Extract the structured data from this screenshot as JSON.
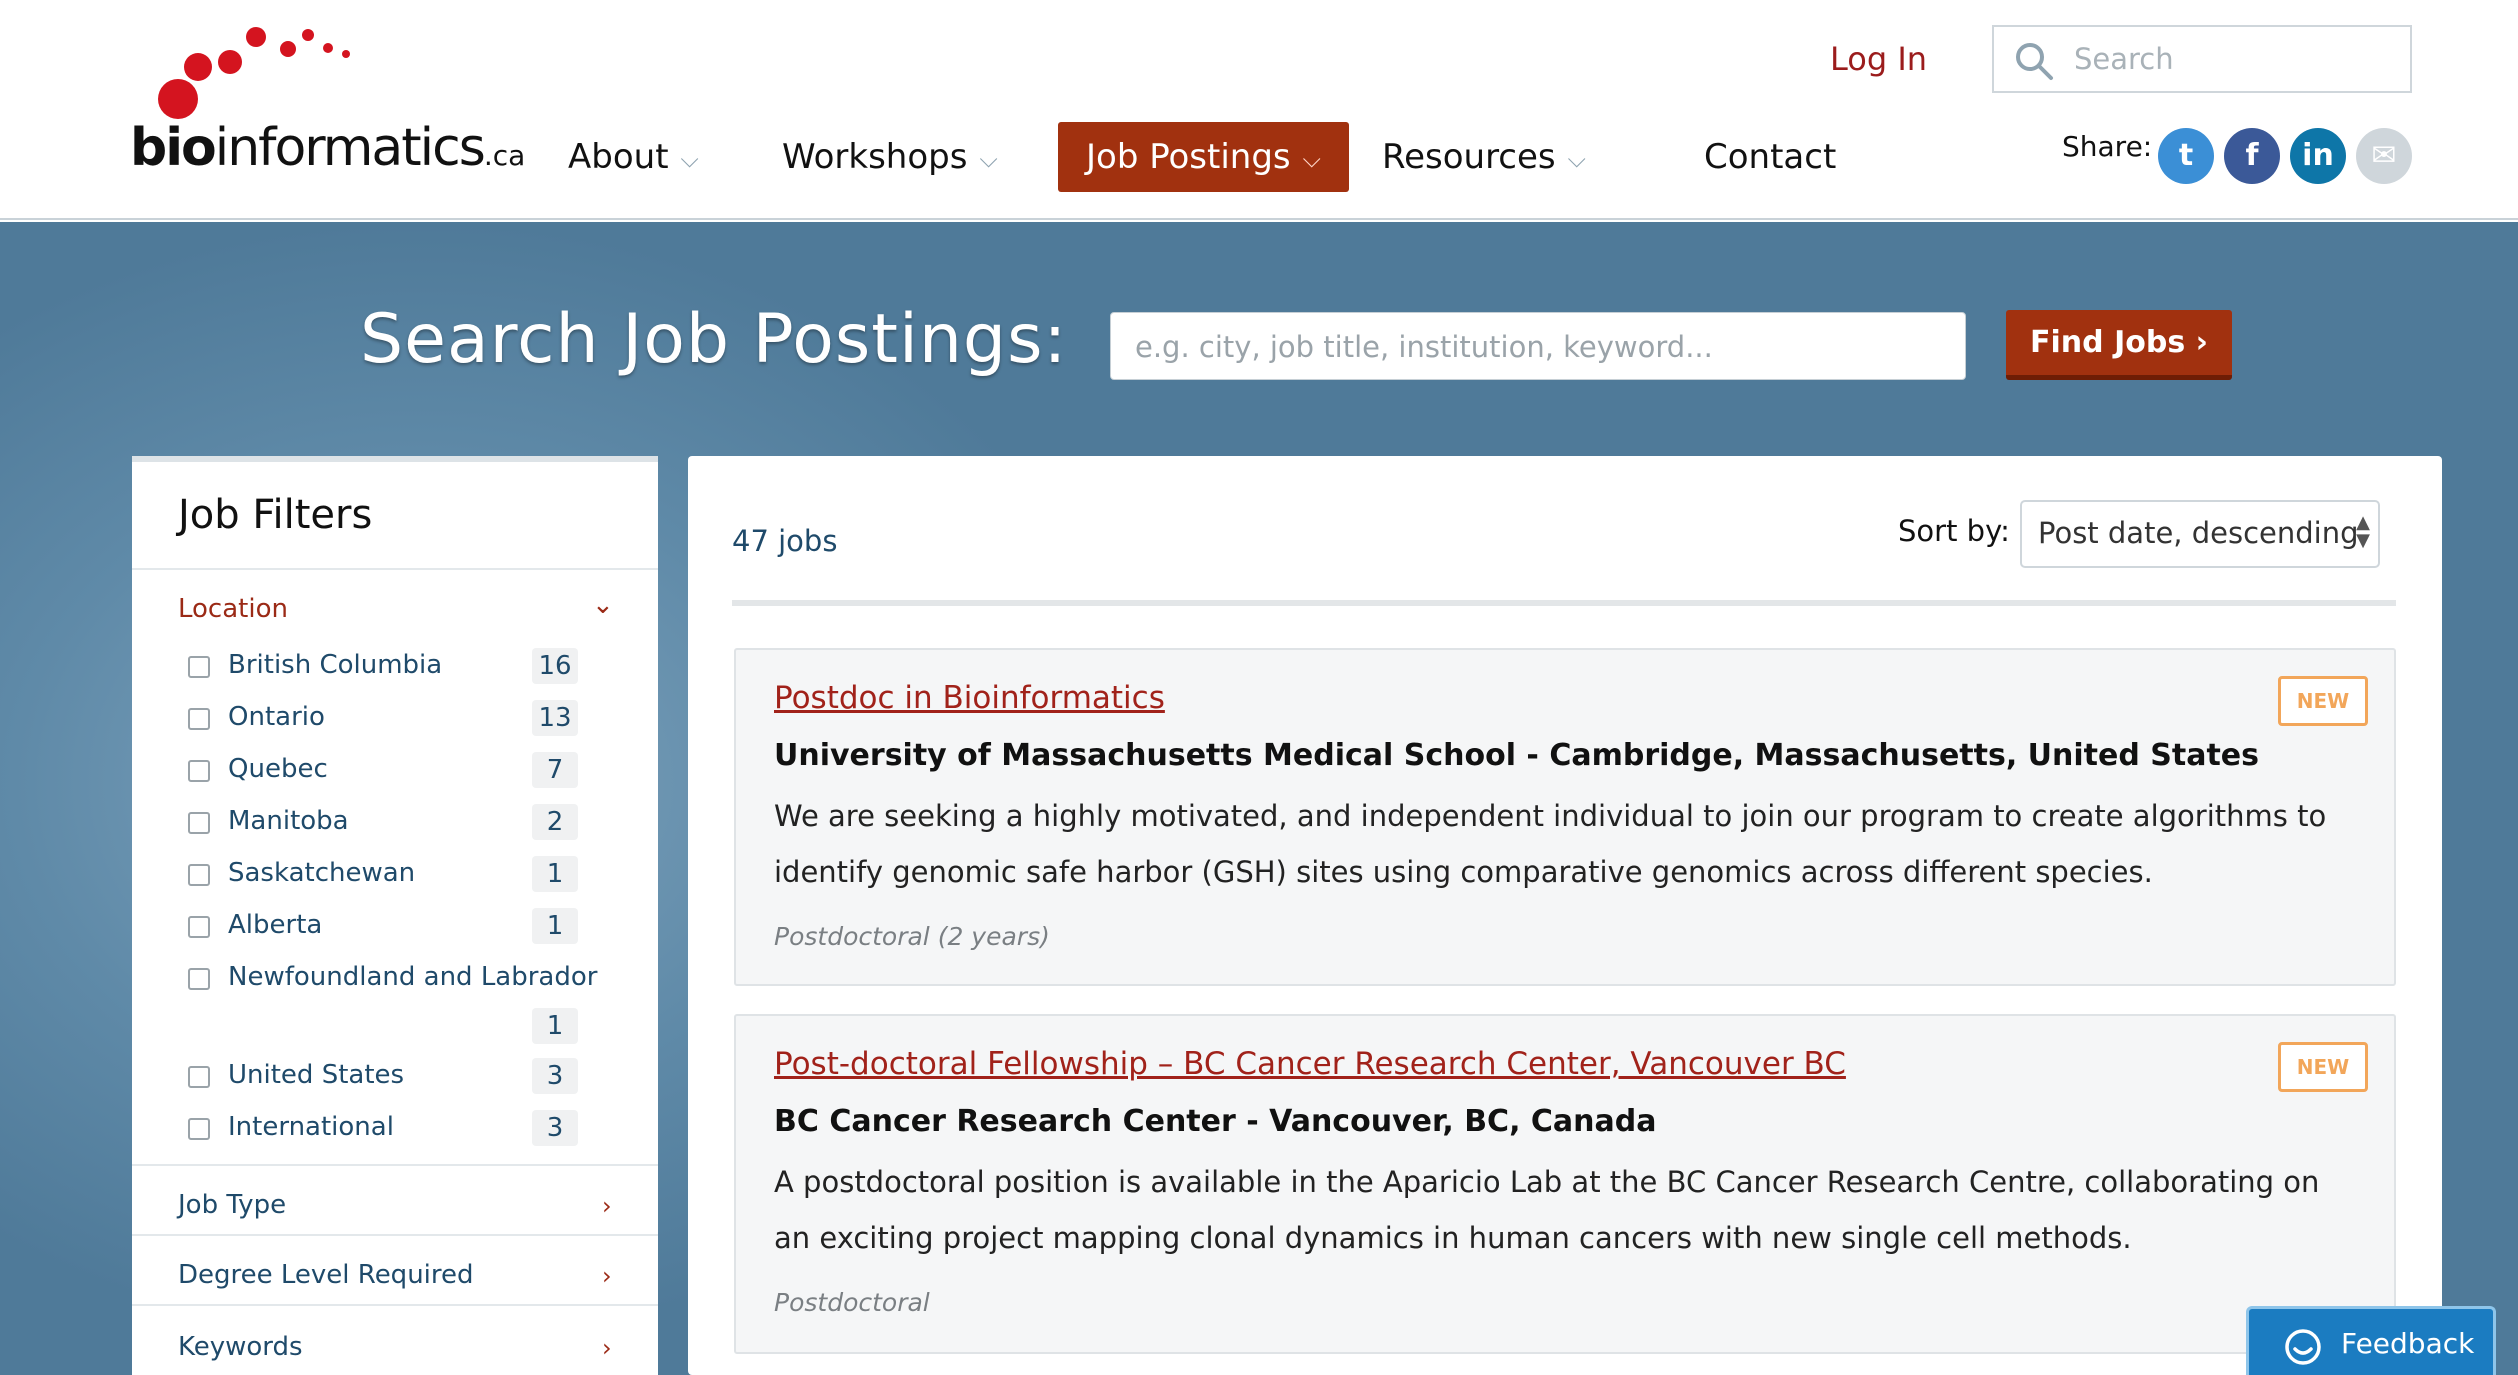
{
  "header": {
    "logo": {
      "bold": "bio",
      "rest": "informatics",
      "suffix": ".ca"
    },
    "login_label": "Log In",
    "search_placeholder": "Search",
    "nav": [
      {
        "label": "About",
        "has_dropdown": true
      },
      {
        "label": "Workshops",
        "has_dropdown": true
      },
      {
        "label": "Job Postings",
        "has_dropdown": true,
        "active": true
      },
      {
        "label": "Resources",
        "has_dropdown": true
      },
      {
        "label": "Contact",
        "has_dropdown": false
      }
    ],
    "share_label": "Share:",
    "share": [
      {
        "name": "twitter-icon",
        "glyph": "t"
      },
      {
        "name": "facebook-icon",
        "glyph": "f"
      },
      {
        "name": "linkedin-icon",
        "glyph": "in"
      },
      {
        "name": "email-icon",
        "glyph": "✉"
      }
    ]
  },
  "hero": {
    "title": "Search Job Postings:",
    "search_placeholder": "e.g. city, job title, institution, keyword...",
    "find_button": "Find Jobs ›"
  },
  "filters": {
    "title": "Job Filters",
    "location": {
      "label": "Location",
      "expanded": true,
      "items": [
        {
          "label": "British Columbia",
          "count": "16",
          "checked": false
        },
        {
          "label": "Ontario",
          "count": "13",
          "checked": false
        },
        {
          "label": "Quebec",
          "count": "7",
          "checked": false
        },
        {
          "label": "Manitoba",
          "count": "2",
          "checked": false
        },
        {
          "label": "Saskatchewan",
          "count": "1",
          "checked": false
        },
        {
          "label": "Alberta",
          "count": "1",
          "checked": false
        },
        {
          "label": "Newfoundland and Labrador",
          "count": "1",
          "checked": false
        },
        {
          "label": "United States",
          "count": "3",
          "checked": false
        },
        {
          "label": "International",
          "count": "3",
          "checked": false
        }
      ]
    },
    "sections": [
      {
        "label": "Job Type"
      },
      {
        "label": "Degree Level Required"
      },
      {
        "label": "Keywords"
      }
    ]
  },
  "results": {
    "count_text": "47 jobs",
    "sort_label": "Sort by:",
    "sort_value": "Post date, descending",
    "jobs": [
      {
        "title": "Postdoc in Bioinformatics",
        "org": "University of Massachusetts Medical School - Cambridge, Massachusetts, United States",
        "description": "We are seeking a highly motivated, and independent individual to join our program to create algorithms to identify genomic safe harbor (GSH) sites using comparative genomics across different species.",
        "meta": "Postdoctoral (2 years)",
        "badge": "NEW"
      },
      {
        "title": "Post-doctoral Fellowship – BC Cancer Research Center, Vancouver BC",
        "org": "BC Cancer Research Center - Vancouver, BC, Canada",
        "description": "A postdoctoral position is available in the Aparicio Lab at the BC Cancer Research Centre, collaborating on an exciting project mapping clonal dynamics in human cancers with new single cell methods.",
        "meta": "Postdoctoral",
        "badge": "NEW"
      }
    ]
  },
  "feedback_label": "Feedback",
  "colors": {
    "accent": "#a1310f",
    "link": "#a1221a",
    "filter_text": "#1f4a6a",
    "badge": "#f2a65a",
    "hero_bg": "#4f7a99",
    "feedback": "#1b7cc1"
  }
}
